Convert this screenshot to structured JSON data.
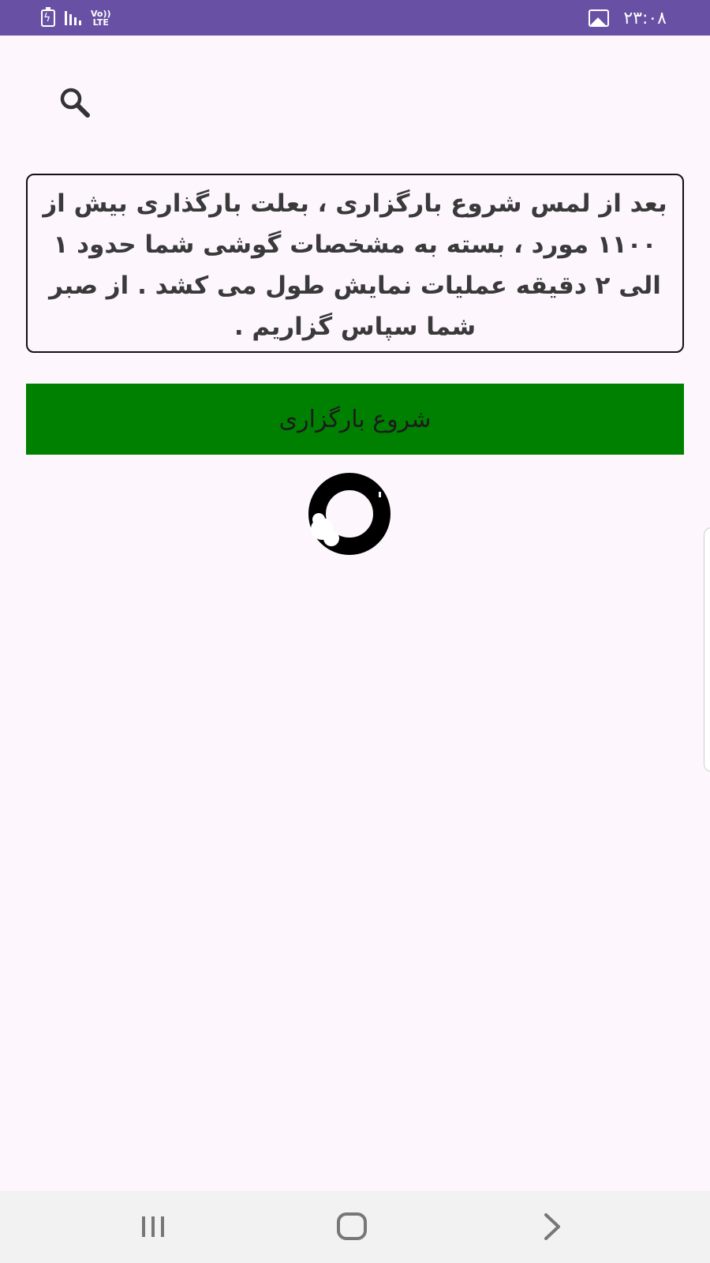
{
  "status_bar": {
    "network_label_top": "Vo))",
    "network_label_bottom": "LTE",
    "time": "۲۳:۰۸",
    "background_color": "#6850a4",
    "icons": [
      "battery-charging-icon",
      "signal-icon",
      "volte-lte-icon",
      "gallery-notification-icon"
    ]
  },
  "search": {
    "icon": "search-icon"
  },
  "info_box": {
    "text": "بعد از لمس شروع بارگزاری ، بعلت بارگذاری بیش از ۱۱۰۰ مورد ، بسته به مشخصات گوشی شما حدود ۱ الی ۲ دقیقه عملیات نمایش طول می کشد . از صبر شما سپاس گزاریم ."
  },
  "start_button": {
    "label": "شروع بارگزاری",
    "background_color": "#008000"
  },
  "loading": {
    "icon": "loading-spinner-icon"
  },
  "nav_bar": {
    "icons": [
      "recent-apps-icon",
      "home-icon",
      "back-icon"
    ]
  }
}
